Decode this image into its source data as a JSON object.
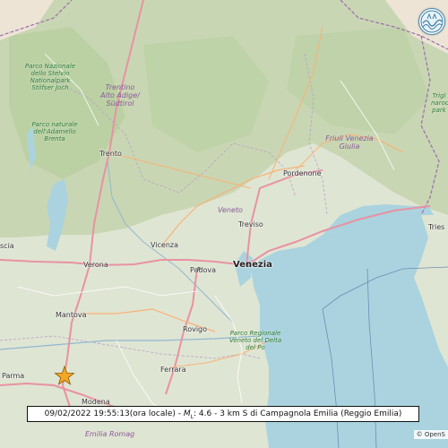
{
  "cities": {
    "trento": "Trento",
    "pordenone": "Pordenone",
    "treviso": "Treviso",
    "vicenza": "Vicenza",
    "verona": "Verona",
    "padova": "Padova",
    "venezia": "Venezia",
    "mantova": "Mantova",
    "rovigo": "Rovigo",
    "ferrara": "Ferrara",
    "parma": "Parma",
    "modena": "Modena",
    "trieste": "Tries",
    "brescia": "scia"
  },
  "regions": {
    "veneto": "Veneto",
    "friuli": "Friuli Venezia Giulia",
    "trentino": "Trentino Alto Adige/ Südtirol",
    "emilia": "Emilia Romag"
  },
  "parks": {
    "stelvio": "Parco Nazionale dello Stelvio Nationalpark Stilfser Joch",
    "adamello": "Parco naturale dell'Adamello Brenta",
    "delta": "Parco Regionale Veneto del Delta del Po",
    "triglav": "Trigl narod park"
  },
  "event": {
    "datetime": "09/02/2022 19:55:13(ora locale)",
    "sep": " - ",
    "mag_letter": "M",
    "mag_sub": "L",
    "mag_value": ": 4.6",
    "location": " - 3 km S di Campagnola Emilia (Reggio Emilia)"
  },
  "attribution": "© OpenS",
  "logo": "ingv-logo-icon",
  "colors": {
    "land": "#dfe5d3",
    "mountains": "#c9d6b3",
    "forest": "#b8d0a0",
    "sea": "#aad3df",
    "lake": "#aad3df",
    "motorway": "#e892a2",
    "primary_road": "#f9b277",
    "border": "#9b6dae",
    "star": "#f5a623"
  }
}
